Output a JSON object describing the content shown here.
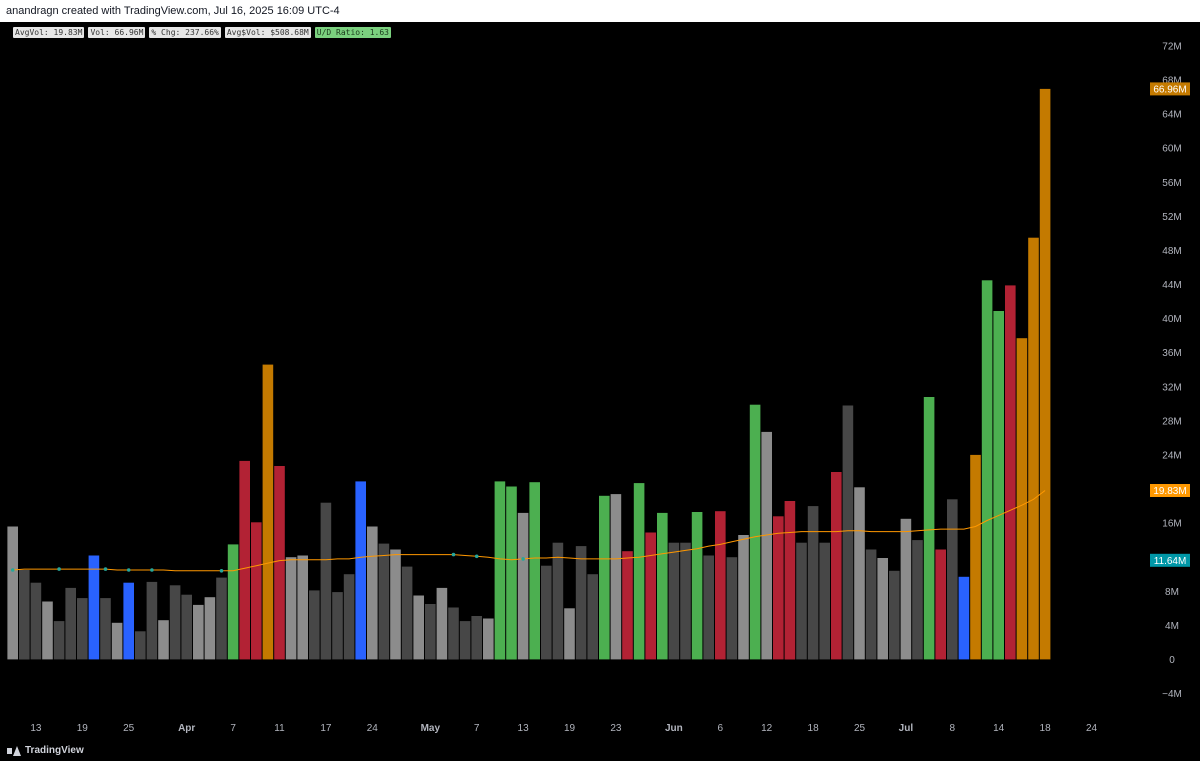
{
  "header": {
    "title": "anandragn created with TradingView.com, Jul 16, 2025 16:09 UTC-4"
  },
  "legend": {
    "items": [
      {
        "text": "AvgVol: 19.83M",
        "color": "#e6e6e6"
      },
      {
        "text": "Vol: 66.96M",
        "color": "#e6e6e6"
      },
      {
        "text": "% Chg: 237.66%",
        "color": "#e6e6e6"
      },
      {
        "text": "Avg$Vol: $508.68M",
        "color": "#e6e6e6"
      },
      {
        "text": "U/D Ratio: 1.63",
        "color": "#7bd17f"
      }
    ]
  },
  "footer": {
    "logo_text": "TradingView",
    "logo_icon": "tradingview-logo-icon"
  },
  "colors": {
    "up": "#4caf50",
    "down": "#b22234",
    "pocket": "#2962ff",
    "big": "#c47a00",
    "light": "#8c8c8c",
    "dark": "#474747",
    "ma": "#ff9800",
    "dot": "#26a69a",
    "last_label": "#c47a00",
    "avg_label": "#ff9800",
    "cyan_label": "#0097a7"
  },
  "chart_data": {
    "type": "bar",
    "title": "",
    "xlabel": "",
    "ylabel": "",
    "ylim": [
      -6,
      74
    ],
    "unit": "M",
    "grid": false,
    "yticks": [
      "72M",
      "68M",
      "64M",
      "60M",
      "56M",
      "52M",
      "48M",
      "44M",
      "40M",
      "36M",
      "32M",
      "28M",
      "24M",
      "20M",
      "16M",
      "8M",
      "4M",
      "0",
      "−4M"
    ],
    "ytick_values": [
      72,
      68,
      64,
      60,
      56,
      52,
      48,
      44,
      40,
      36,
      32,
      28,
      24,
      20,
      16,
      8,
      4,
      0,
      -4
    ],
    "xticks": [
      {
        "label": "13",
        "index": 2,
        "bold": false
      },
      {
        "label": "19",
        "index": 6,
        "bold": false
      },
      {
        "label": "25",
        "index": 10,
        "bold": false
      },
      {
        "label": "Apr",
        "index": 15,
        "bold": true
      },
      {
        "label": "7",
        "index": 19,
        "bold": false
      },
      {
        "label": "11",
        "index": 23,
        "bold": false
      },
      {
        "label": "17",
        "index": 27,
        "bold": false
      },
      {
        "label": "24",
        "index": 31,
        "bold": false
      },
      {
        "label": "May",
        "index": 36,
        "bold": true
      },
      {
        "label": "7",
        "index": 40,
        "bold": false
      },
      {
        "label": "13",
        "index": 44,
        "bold": false
      },
      {
        "label": "19",
        "index": 48,
        "bold": false
      },
      {
        "label": "23",
        "index": 52,
        "bold": false
      },
      {
        "label": "Jun",
        "index": 57,
        "bold": true
      },
      {
        "label": "6",
        "index": 61,
        "bold": false
      },
      {
        "label": "12",
        "index": 65,
        "bold": false
      },
      {
        "label": "18",
        "index": 69,
        "bold": false
      },
      {
        "label": "25",
        "index": 73,
        "bold": false
      },
      {
        "label": "Jul",
        "index": 77,
        "bold": true
      },
      {
        "label": "8",
        "index": 81,
        "bold": false
      },
      {
        "label": "14",
        "index": 85,
        "bold": false
      },
      {
        "label": "18",
        "index": 89,
        "bold": false
      },
      {
        "label": "24",
        "index": 93,
        "bold": false
      }
    ],
    "series": [
      {
        "kind": "volume",
        "values": [
          15.6,
          10.5,
          9.0,
          6.8,
          4.5,
          8.4,
          7.2,
          12.2,
          7.2,
          4.3,
          9.0,
          3.3,
          9.1,
          4.6,
          8.7,
          7.6,
          6.4,
          7.3,
          9.6,
          13.5,
          23.3,
          16.1,
          34.6,
          22.7,
          12.0,
          12.2,
          8.1,
          18.4,
          7.9,
          10.0,
          20.9,
          15.6,
          13.6,
          12.9,
          10.9,
          7.5,
          6.5,
          8.4,
          6.1,
          4.5,
          5.1,
          4.8,
          20.9,
          20.3,
          17.2,
          20.8,
          11.0,
          13.7,
          6.0,
          13.3,
          10.0,
          19.2,
          19.4,
          12.7,
          20.7,
          14.9,
          17.2,
          13.7,
          13.7,
          17.3,
          12.2,
          17.4,
          12.0,
          14.6,
          29.9,
          26.7,
          16.8,
          18.6,
          13.7,
          18.0,
          13.7,
          22.0,
          29.8,
          20.2,
          12.9,
          11.9,
          10.4,
          16.5,
          14.0,
          30.8,
          12.9,
          18.8,
          9.7,
          24.0,
          44.5,
          40.9,
          43.9,
          37.7,
          49.5,
          66.96
        ],
        "categories": [
          "up",
          "down",
          "pocket",
          "big",
          "light",
          "dark"
        ],
        "colors": [
          "light",
          "dark",
          "dark",
          "light",
          "dark",
          "dark",
          "dark",
          "pocket",
          "dark",
          "light",
          "pocket",
          "dark",
          "dark",
          "light",
          "dark",
          "dark",
          "light",
          "light",
          "dark",
          "up",
          "down",
          "down",
          "big",
          "down",
          "light",
          "light",
          "dark",
          "dark",
          "dark",
          "dark",
          "pocket",
          "light",
          "dark",
          "light",
          "dark",
          "light",
          "dark",
          "light",
          "dark",
          "dark",
          "dark",
          "light",
          "up",
          "up",
          "light",
          "up",
          "dark",
          "dark",
          "light",
          "dark",
          "dark",
          "up",
          "light",
          "down",
          "up",
          "down",
          "up",
          "dark",
          "dark",
          "up",
          "dark",
          "down",
          "dark",
          "light",
          "up",
          "light",
          "down",
          "down",
          "dark",
          "dark",
          "dark",
          "down",
          "dark",
          "light",
          "dark",
          "light",
          "dark",
          "light",
          "dark",
          "up",
          "down",
          "dark",
          "pocket",
          "big",
          "up",
          "up",
          "down",
          "big",
          "big",
          "big"
        ]
      },
      {
        "kind": "moving_average",
        "values": [
          10.5,
          10.6,
          10.6,
          10.6,
          10.6,
          10.6,
          10.6,
          10.6,
          10.6,
          10.5,
          10.5,
          10.5,
          10.5,
          10.5,
          10.4,
          10.4,
          10.4,
          10.4,
          10.4,
          10.4,
          10.7,
          11.0,
          11.3,
          11.6,
          11.7,
          11.7,
          11.7,
          11.7,
          11.8,
          11.8,
          12.0,
          12.1,
          12.2,
          12.3,
          12.3,
          12.3,
          12.3,
          12.3,
          12.3,
          12.2,
          12.1,
          12.0,
          11.8,
          11.7,
          11.8,
          11.9,
          11.9,
          12.0,
          11.9,
          11.8,
          11.8,
          11.8,
          11.8,
          11.9,
          12.0,
          12.2,
          12.4,
          12.6,
          12.8,
          13.0,
          13.3,
          13.5,
          13.8,
          14.1,
          14.4,
          14.6,
          14.8,
          14.9,
          15.0,
          15.0,
          15.0,
          15.0,
          15.1,
          15.1,
          15.0,
          15.0,
          15.0,
          15.0,
          15.1,
          15.2,
          15.3,
          15.3,
          15.3,
          15.6,
          16.3,
          16.9,
          17.5,
          18.1,
          18.8,
          19.83
        ]
      }
    ],
    "ma_dots_at": [
      0,
      4,
      8,
      10,
      12,
      18,
      38,
      40,
      44
    ],
    "price_labels": [
      {
        "text": "66.96M",
        "value": 66.96,
        "color": "last_label"
      },
      {
        "text": "19.83M",
        "value": 19.83,
        "color": "avg_label"
      },
      {
        "text": "11.64M",
        "value": 11.64,
        "color": "cyan_label"
      }
    ]
  }
}
